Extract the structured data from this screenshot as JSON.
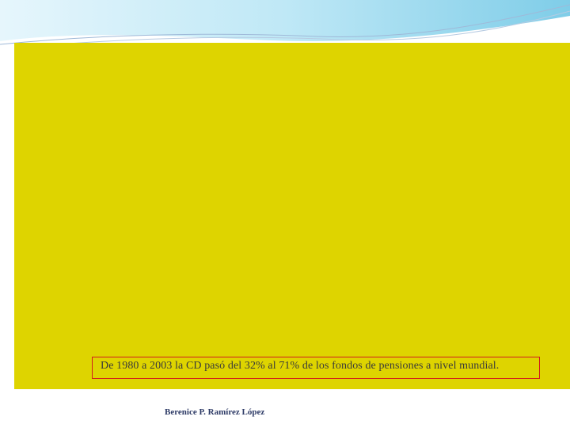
{
  "slide": {
    "caption": "De 1980 a 2003 la CD pasó del 32%  al 71% de los fondos de pensiones a nivel mundial.",
    "author": "Berenice P. Ramírez López"
  },
  "colors": {
    "panel": "#ded400",
    "caption_border": "#d21c1c",
    "wave_light": "#bfe8f6",
    "wave_mid": "#7fcde8",
    "wave_line": "#9fb9d8"
  }
}
